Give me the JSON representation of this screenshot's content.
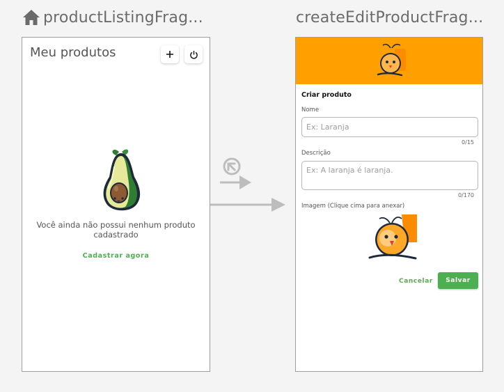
{
  "nav_graph": {
    "start_fragment": "productListingFrag...",
    "target_fragment": "createEditProductFrag..."
  },
  "product_listing": {
    "title": "Meu produtos",
    "add_icon": "plus-icon",
    "power_icon": "power-icon",
    "empty_line1": "Você ainda não possui nenhum produto",
    "empty_line2": "cadastrado",
    "register_link": "Cadastrar agora"
  },
  "create_edit_product": {
    "header_title": "Criar produto",
    "name_label": "Nome",
    "name_placeholder": "Ex: Laranja",
    "name_counter": "0/15",
    "description_label": "Descrição",
    "description_placeholder": "Ex: A laranja é laranja.",
    "description_counter": "0/170",
    "image_label": "Imagem (Clique cima para anexar)",
    "cancel_button": "Cancelar",
    "save_button": "Salvar"
  },
  "colors": {
    "banner": "#ffa000",
    "accent_green": "#4caf50",
    "arrow_gray": "#bdbdbd",
    "background": "#f4f4f4"
  }
}
